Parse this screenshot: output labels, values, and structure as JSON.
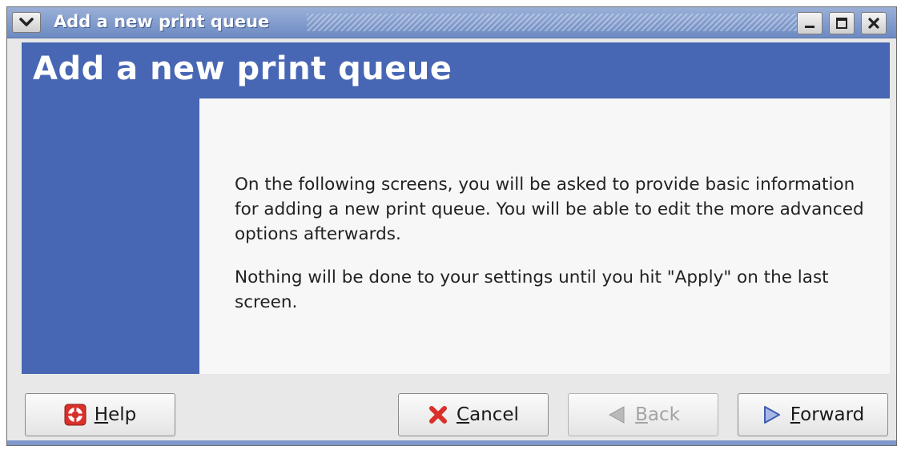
{
  "window": {
    "title": "Add a new print queue"
  },
  "header": {
    "title": "Add a new print queue"
  },
  "content": {
    "paragraph1": "On the following screens, you will be asked to provide basic information for adding a new print queue.  You will be able to edit the more advanced options afterwards.",
    "paragraph2": "Nothing will be done to your settings until you hit \"Apply\" on the last screen."
  },
  "buttons": {
    "help": {
      "mnemonic": "H",
      "rest": "elp",
      "icon": "help-lifebuoy-icon",
      "enabled": true
    },
    "cancel": {
      "mnemonic": "C",
      "rest": "ancel",
      "icon": "red-x-icon",
      "enabled": true
    },
    "back": {
      "mnemonic": "B",
      "rest": "ack",
      "icon": "left-arrow-icon",
      "enabled": false
    },
    "forward": {
      "mnemonic": "F",
      "rest": "orward",
      "icon": "right-arrow-icon",
      "enabled": true
    }
  },
  "colors": {
    "accent": "#4766b3",
    "titlebar": "#7f97cb",
    "cancel_icon": "#d9302a",
    "forward_icon": "#5d7ccc"
  }
}
